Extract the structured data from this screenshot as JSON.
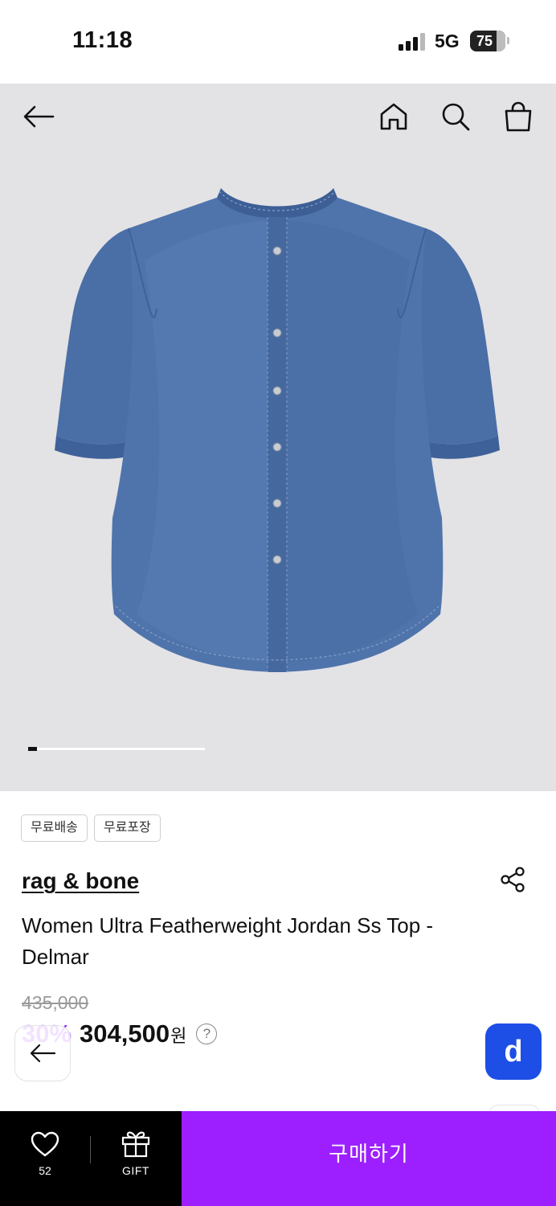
{
  "status_bar": {
    "time": "11:18",
    "network": "5G",
    "battery": "75",
    "battery_level": 0.75
  },
  "header": {
    "icons": [
      "back-arrow-icon",
      "home-icon",
      "search-icon",
      "shopping-bag-icon"
    ]
  },
  "gallery": {
    "image": "denim-short-sleeve-top",
    "progress_fraction": 0.05
  },
  "product": {
    "tags": [
      "무료배송",
      "무료포장"
    ],
    "brand": "rag & bone",
    "title": "Women Ultra Featherweight Jordan Ss Top - Delmar",
    "original_price": "435,000",
    "discount": "30%",
    "price": "304,500",
    "currency": "원",
    "help": "?"
  },
  "floating": {
    "d_label": "d"
  },
  "bottom_bar": {
    "like_count": "52",
    "gift_label": "GIFT",
    "buy_label": "구매하기"
  },
  "colors": {
    "accent": "#9d1fff",
    "discount": "#a335ff",
    "d_button": "#1d4ee6",
    "hero_bg": "#e3e2e5",
    "denim": "#4a6ea6"
  }
}
